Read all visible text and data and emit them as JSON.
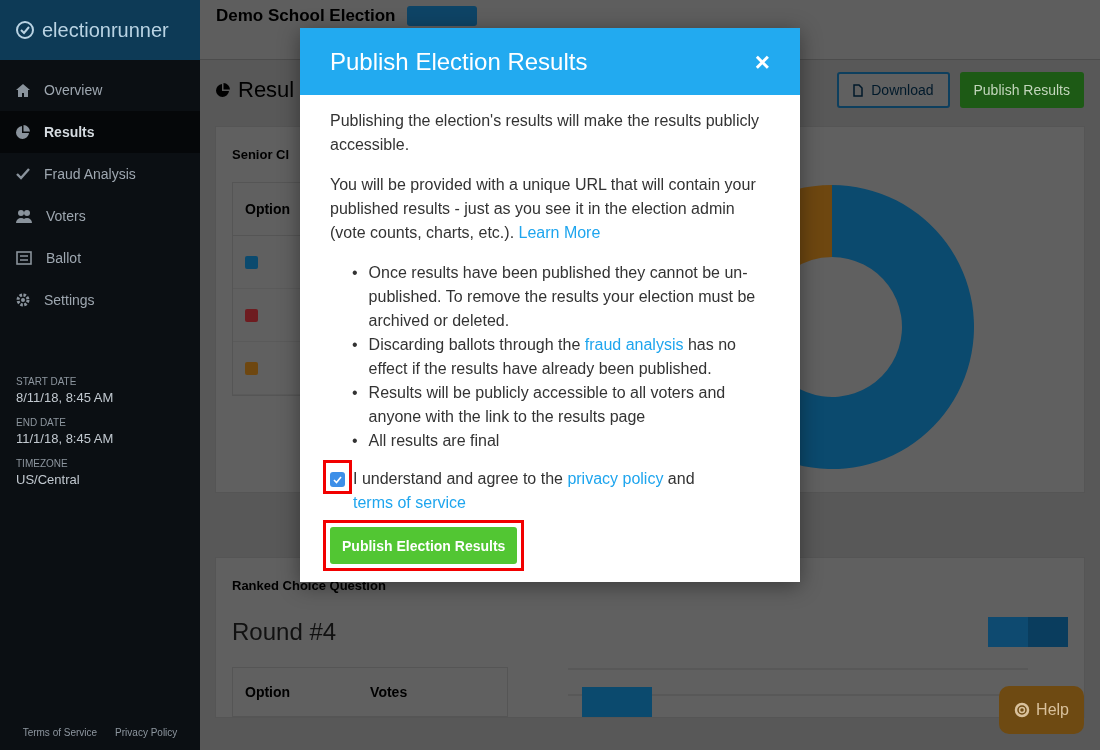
{
  "sidebar": {
    "logo": "electionrunner",
    "items": [
      {
        "label": "Overview",
        "selected": false
      },
      {
        "label": "Results",
        "selected": true
      },
      {
        "label": "Fraud Analysis",
        "selected": false
      },
      {
        "label": "Voters",
        "selected": false
      },
      {
        "label": "Ballot",
        "selected": false
      },
      {
        "label": "Settings",
        "selected": false
      }
    ],
    "dates": [
      {
        "label": "START DATE",
        "value": "8/11/18, 8:45 AM"
      },
      {
        "label": "END DATE",
        "value": "11/1/18, 8:45 AM"
      },
      {
        "label": "TIMEZONE",
        "value": "US/Central"
      }
    ],
    "footer_links": [
      "Terms of Service",
      "Privacy Policy"
    ]
  },
  "header": {
    "title": "Demo School Election"
  },
  "results": {
    "title": "Resul",
    "buttons": [
      {
        "label": "Download",
        "kind": "outline"
      },
      {
        "label": "Publish Results",
        "kind": "primary"
      }
    ]
  },
  "question_card": {
    "title": "Senior Cl",
    "column": "Option",
    "options": [
      {
        "color": "#0b4a6e"
      },
      {
        "color": "#6e1c20"
      },
      {
        "color": "#6e4710"
      }
    ]
  },
  "ranked_card": {
    "title": "Ranked Choice Question",
    "round": "Round #4",
    "columns": [
      "Option",
      "Votes"
    ]
  },
  "modal": {
    "title": "Publish Election Results",
    "close": "×",
    "paragraphs": [
      [
        {
          "text": "Publishing the election's results will make the results publicly accessible."
        }
      ],
      [
        {
          "text": "You will be provided with a unique URL that will contain your published results - just as you see it in the election admin (vote counts, charts, etc.). "
        },
        {
          "text": "Learn More",
          "link": true
        }
      ]
    ],
    "bullets": [
      {
        "marker": "•",
        "segments": [
          {
            "text": "Once results have been published they cannot be un-published. To remove the results your election must be archived or deleted."
          }
        ]
      },
      {
        "marker": "•",
        "segments": [
          {
            "text": "Discarding ballots through the "
          },
          {
            "text": "fraud analysis",
            "link": true
          },
          {
            "text": " has no effect if the results have already been published."
          }
        ]
      },
      {
        "marker": "•",
        "segments": [
          {
            "text": "Results will be publicly accessible to all voters and anyone with the link to the results page"
          }
        ]
      },
      {
        "marker": "•",
        "segments": [
          {
            "text": "All results are final"
          }
        ]
      }
    ],
    "agree": {
      "checked": true,
      "segments": [
        {
          "text": "I understand and agree to the "
        },
        {
          "text": "privacy policy",
          "link": true
        },
        {
          "text": " and "
        },
        {
          "text": "terms of service",
          "link": true
        }
      ]
    },
    "button": "Publish Election Results"
  },
  "help": {
    "label": "Help"
  }
}
